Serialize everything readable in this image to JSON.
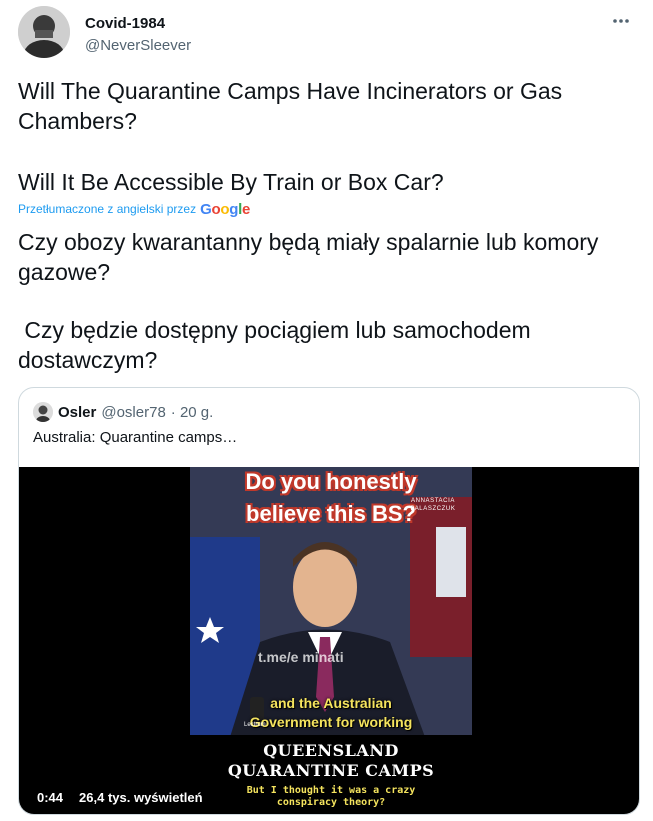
{
  "tweet": {
    "author": {
      "display_name": "Covid-1984",
      "handle": "@NeverSleever",
      "avatar": "user-avatar"
    },
    "more_icon": "more-horizontal-icon",
    "text_lines": [
      "Will The Quarantine Camps Have Incinerators or Gas Chambers?",
      "Will It Be Accessible By Train or Box Car?"
    ],
    "translation": {
      "label": "Przetłumaczone z angielski przez",
      "provider": "Google",
      "provider_colors": [
        "#4285F4",
        "#EA4335",
        "#FBBC05",
        "#4285F4",
        "#34A853",
        "#EA4335"
      ],
      "lines": [
        "Czy obozy kwarantanny będą miały spalarnie lub komory gazowe?",
        " Czy będzie dostępny pociągiem lub samochodem dostawczym?"
      ]
    }
  },
  "quote": {
    "author": {
      "display_name": "Osler",
      "handle": "@osler78",
      "time": "· 20 g."
    },
    "text": "Australia: Quarantine camps…",
    "video": {
      "caption_top": [
        "Do you honestly",
        "believe this BS?"
      ],
      "brand": "ANNASTACIA PALASZCZUK",
      "watermark": "t.me/e    minati",
      "subtitle": [
        "and the Australian",
        "Government for working"
      ],
      "small_logo": "Lectrum",
      "title": [
        "QUEENSLAND",
        "QUARANTINE CAMPS"
      ],
      "subtitle_bottom": [
        "But I thought it was a crazy",
        "conspiracy theory?"
      ],
      "duration": "0:44",
      "views": "26,4 tys. wyświetleń"
    }
  },
  "colors": {
    "link": "#1d9bf0",
    "secondary_text": "#536471",
    "border": "#cfd9de",
    "caption_red": "#c0392b",
    "subtitle_yellow": "#f5e45e"
  }
}
